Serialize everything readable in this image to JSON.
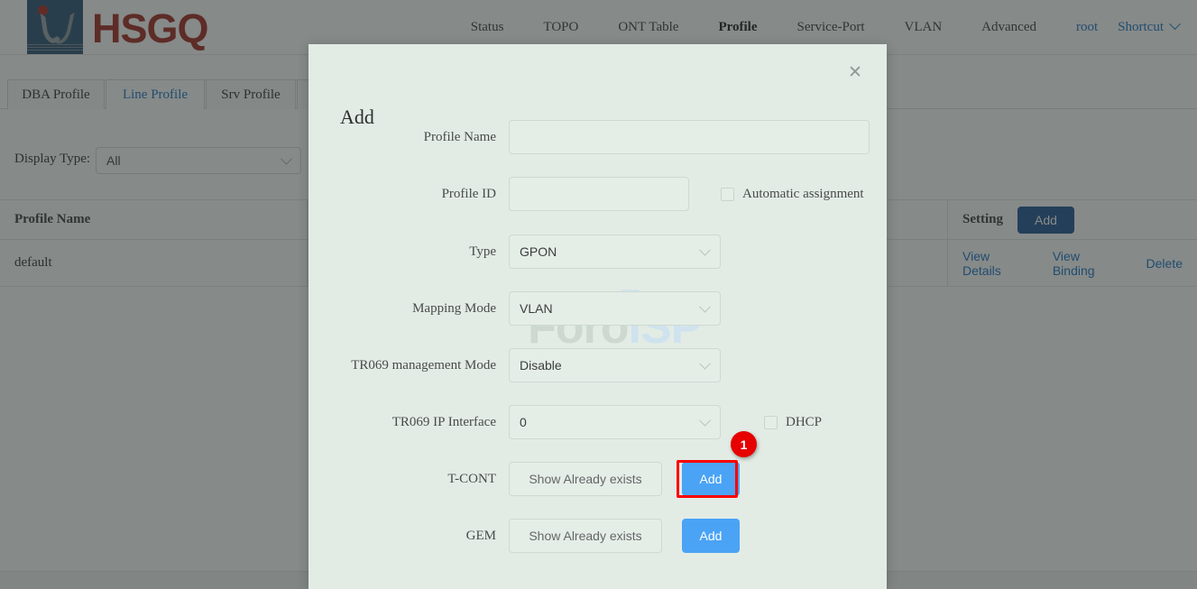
{
  "brand": {
    "name": "HSGQ"
  },
  "nav": {
    "items": [
      {
        "label": "Status",
        "active": false
      },
      {
        "label": "TOPO",
        "active": false
      },
      {
        "label": "ONT Table",
        "active": false
      },
      {
        "label": "Profile",
        "active": true
      },
      {
        "label": "Service-Port",
        "active": false
      },
      {
        "label": "VLAN",
        "active": false
      },
      {
        "label": "Advanced",
        "active": false
      }
    ],
    "user": "root",
    "shortcut": "Shortcut"
  },
  "tabs": [
    {
      "label": "DBA Profile",
      "active": false
    },
    {
      "label": "Line Profile",
      "active": true
    },
    {
      "label": "Srv Profile",
      "active": false
    }
  ],
  "filter": {
    "label": "Display Type:",
    "value": "All"
  },
  "table": {
    "headers": {
      "profile_name": "Profile Name",
      "setting": "Setting"
    },
    "header_add_button": "Add",
    "rows": [
      {
        "profile_name": "default",
        "actions": [
          "View Details",
          "View Binding",
          "Delete"
        ]
      }
    ]
  },
  "modal": {
    "title": "Add",
    "close_icon": "close-icon",
    "watermark": {
      "part1": "Foro",
      "part2": "ISP"
    },
    "fields": {
      "profile_name": {
        "label": "Profile Name",
        "value": "",
        "placeholder": ""
      },
      "profile_id": {
        "label": "Profile ID",
        "value": "",
        "placeholder": ""
      },
      "automatic_assignment": {
        "label": "Automatic assignment",
        "checked": false
      },
      "type": {
        "label": "Type",
        "value": "GPON"
      },
      "mapping_mode": {
        "label": "Mapping Mode",
        "value": "VLAN"
      },
      "tr069_management_mode": {
        "label": "TR069 management Mode",
        "value": "Disable"
      },
      "tr069_ip_interface": {
        "label": "TR069 IP Interface",
        "value": "0"
      },
      "dhcp": {
        "label": "DHCP",
        "checked": false
      },
      "tcont": {
        "label": "T-CONT",
        "show_button": "Show Already exists",
        "add_button": "Add"
      },
      "gem": {
        "label": "GEM",
        "show_button": "Show Already exists",
        "add_button": "Add"
      }
    }
  },
  "annotation": {
    "step_number": "1"
  },
  "colors": {
    "brand_red": "#a22b20",
    "logo_blue": "#2d5274",
    "link_blue": "#1a72c4",
    "button_blue": "#4aa3f5",
    "table_button_blue": "#205493",
    "modal_bg": "#e2ece5",
    "highlight_red": "#ff0000",
    "badge_red": "#e60000"
  }
}
